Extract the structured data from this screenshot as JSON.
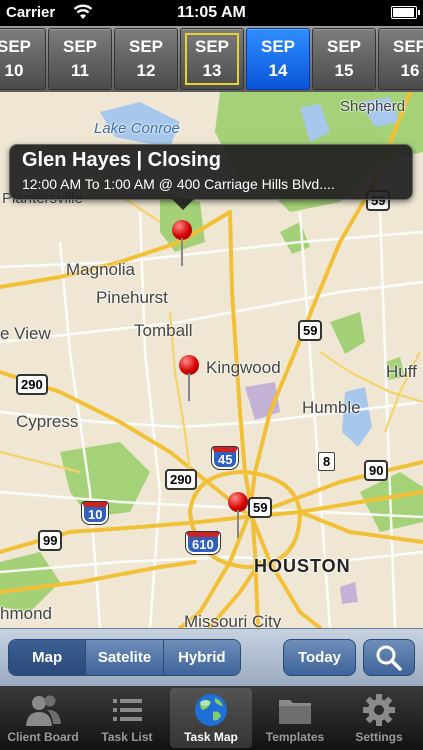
{
  "status_bar": {
    "carrier": "Carrier",
    "time": "11:05 AM",
    "battery_level": 1.0
  },
  "date_strip": {
    "days": [
      {
        "month": "SEP",
        "day": "10"
      },
      {
        "month": "SEP",
        "day": "11"
      },
      {
        "month": "SEP",
        "day": "12"
      },
      {
        "month": "SEP",
        "day": "13",
        "today": true
      },
      {
        "month": "SEP",
        "day": "14",
        "selected": true
      },
      {
        "month": "SEP",
        "day": "15"
      },
      {
        "month": "SEP",
        "day": "16"
      }
    ]
  },
  "map": {
    "callout": {
      "title": "Glen Hayes | Closing",
      "subtitle": "12:00 AM To 1:00 AM @ 400 Carriage Hills Blvd...."
    },
    "labels": {
      "lake_conroe": "Lake Conroe",
      "shepherd": "Shepherd",
      "plantersville": "Plantersville",
      "magnolia": "Magnolia",
      "pinehurst": "Pinehurst",
      "tomball": "Tomball",
      "view": "e View",
      "kingwood": "Kingwood",
      "huff": "Huff",
      "cypress": "Cypress",
      "humble": "Humble",
      "houston": "HOUSTON",
      "missouri_city": "Missouri City",
      "hmond": "hmond"
    },
    "shields": {
      "us59_north": "59",
      "us59_mid": "59",
      "us59_south": "59",
      "sh290_west": "290",
      "sh290_east": "290",
      "i45": "45",
      "sh8": "8",
      "sh90": "90",
      "i10": "10",
      "sh99": "99",
      "i610": "610",
      "top_marker": "45"
    }
  },
  "controls": {
    "map_label": "Map",
    "satellite_label": "Satelite",
    "hybrid_label": "Hybrid",
    "today_label": "Today",
    "active_map_type": "Map"
  },
  "tab_bar": {
    "tabs": [
      {
        "label": "Client Board",
        "icon": "client-board-icon"
      },
      {
        "label": "Task List",
        "icon": "task-list-icon"
      },
      {
        "label": "Task Map",
        "icon": "globe-icon",
        "active": true
      },
      {
        "label": "Templates",
        "icon": "folder-icon"
      },
      {
        "label": "Settings",
        "icon": "gear-icon"
      }
    ]
  },
  "colors": {
    "selected_date": "#0a55d8",
    "today_outline": "#e6d230",
    "freeway": "#f2c036",
    "park": "#9ccf6e",
    "water": "#a7c8ec",
    "pin": "#d30000"
  }
}
